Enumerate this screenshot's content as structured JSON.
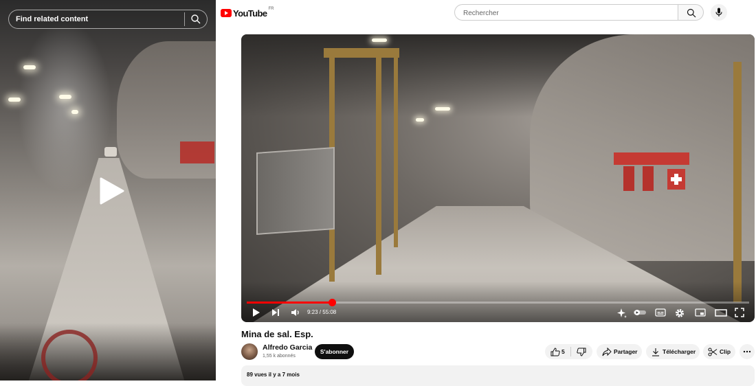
{
  "left_panel": {
    "search_label": "Find related content",
    "search_icon": "search-icon",
    "play_icon": "play-icon"
  },
  "header": {
    "logo_text": "YouTube",
    "region": "FR",
    "search_placeholder": "Rechercher",
    "search_icon": "search-icon",
    "mic_icon": "mic-icon"
  },
  "player": {
    "time": "9:23 / 55:08",
    "progress_fraction": 0.17,
    "controls": [
      "play-icon",
      "next-icon",
      "volume-icon",
      "autoplay-sparkle-icon",
      "autoplay-toggle-icon",
      "subtitles-icon",
      "settings-gear-icon",
      "miniplayer-icon",
      "theater-icon",
      "fullscreen-icon"
    ],
    "accent_color": "#ff0000"
  },
  "video": {
    "title": "Mina de sal. Esp.",
    "channel_name": "Alfredo Garcia",
    "subscribers": "1,55 k abonnés",
    "subscribe_label": "S'abonner",
    "like_count": "5",
    "share_label": "Partager",
    "download_label": "Télécharger",
    "clip_label": "Clip",
    "more_icon": "more-horizontal-icon"
  },
  "description": {
    "meta": "89 vues  il y a 7 mois"
  }
}
